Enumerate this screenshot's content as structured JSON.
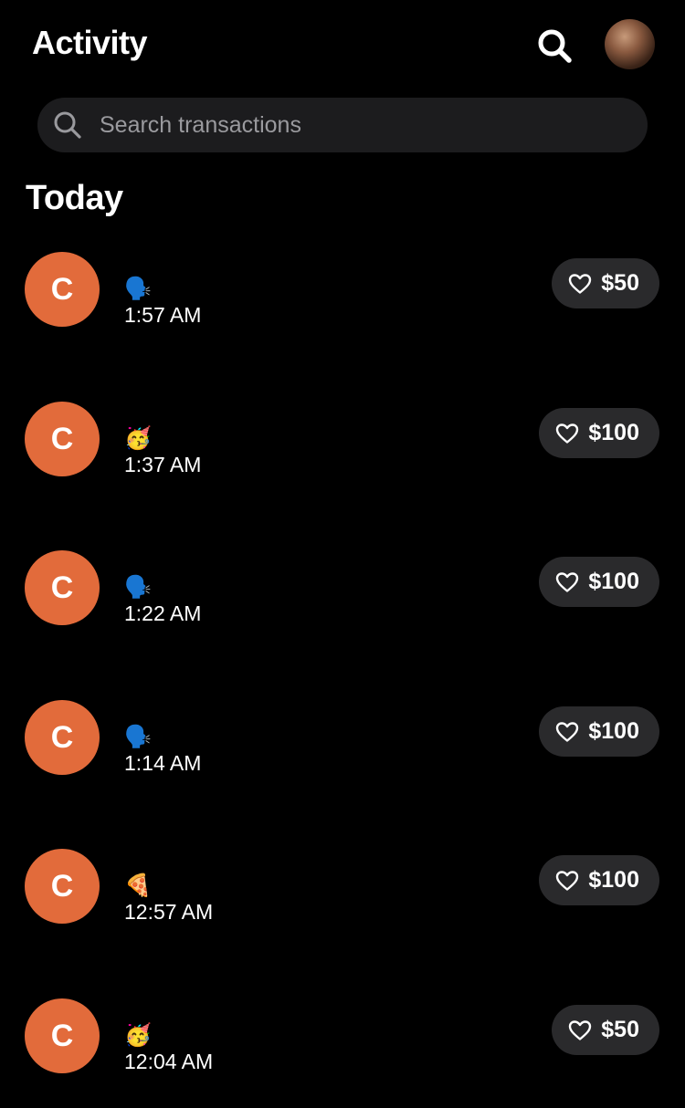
{
  "header": {
    "title": "Activity"
  },
  "search": {
    "placeholder": "Search transactions",
    "value": ""
  },
  "section": {
    "title": "Today"
  },
  "colors": {
    "background": "#000000",
    "avatar_circle": "#e26b3b",
    "pill_bg": "#2a2a2c",
    "search_bg": "#1c1c1e"
  },
  "transactions": [
    {
      "initial": "C",
      "emoji": "🗣️",
      "time": "1:57 AM",
      "amount": "$50"
    },
    {
      "initial": "C",
      "emoji": "🥳",
      "time": "1:37 AM",
      "amount": "$100"
    },
    {
      "initial": "C",
      "emoji": "🗣️",
      "time": "1:22 AM",
      "amount": "$100"
    },
    {
      "initial": "C",
      "emoji": "🗣️",
      "time": "1:14 AM",
      "amount": "$100"
    },
    {
      "initial": "C",
      "emoji": "🍕",
      "time": "12:57 AM",
      "amount": "$100"
    },
    {
      "initial": "C",
      "emoji": "🥳",
      "time": "12:04 AM",
      "amount": "$50"
    }
  ]
}
